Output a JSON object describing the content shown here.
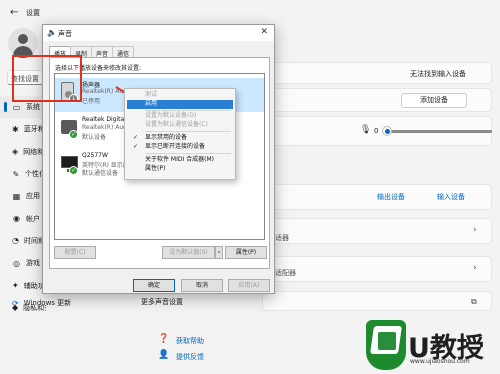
{
  "settings": {
    "back_icon": "←",
    "title": "设置",
    "search_placeholder": "查找设置",
    "nav": [
      {
        "label": "系统",
        "icon": "▭"
      },
      {
        "label": "蓝牙和其他设备",
        "icon": "✱"
      },
      {
        "label": "网络和 Internet",
        "icon": "◈"
      },
      {
        "label": "个性化",
        "icon": "✎"
      },
      {
        "label": "应用",
        "icon": "▦"
      },
      {
        "label": "帐户",
        "icon": "◉"
      },
      {
        "label": "时间和语言",
        "icon": "◔"
      },
      {
        "label": "游戏",
        "icon": "◎"
      },
      {
        "label": "辅助功能",
        "icon": "✦"
      },
      {
        "label": "隐私和安全性",
        "icon": "◆"
      }
    ],
    "windows_update": "Windows 更新",
    "no_device_found": "无法找到输入设备",
    "add_device_button": "添加设备",
    "input_volume": "0",
    "output_device_link": "输出设备",
    "input_device_link": "输入设备",
    "row1_tail": "适器",
    "row2_tail": "适配器",
    "more_sound_settings": "更多声音设置",
    "get_help": "获取帮助",
    "give_feedback": "提供反馈"
  },
  "dialog": {
    "title": "声音",
    "close_icon": "✕",
    "tabs": [
      "播放",
      "录制",
      "声音",
      "通信"
    ],
    "instruction": "选择以下播放设备来修改其设置:",
    "devices": [
      {
        "name": "扬声器",
        "sub": "Realtek(R) Audio",
        "status": "已停用",
        "icon": "speaker-icon"
      },
      {
        "name": "Realtek Digital Output",
        "sub": "Realtek(R) Audio",
        "status": "默认设备",
        "icon": "digital-output-icon"
      },
      {
        "name": "Q2577W",
        "sub": "英特尔(R) 显示器音频",
        "status": "默认通信设备",
        "icon": "monitor-icon"
      }
    ],
    "configure_button": "配置(C)",
    "set_default_button": "设为默认值(S)",
    "properties_button": "属性(P)",
    "ok_button": "确定",
    "cancel_button": "取消",
    "apply_button": "应用(A)"
  },
  "context_menu": {
    "items": [
      {
        "label": "测试",
        "state": "disabled"
      },
      {
        "label": "启用",
        "state": "highlighted"
      },
      {
        "label": "设置为默认设备(D)",
        "state": "disabled"
      },
      {
        "label": "设置为默认通信设备(C)",
        "state": "disabled"
      },
      {
        "label": "显示禁用的设备",
        "state": "checked"
      },
      {
        "label": "显示已断开连接的设备",
        "state": "checked"
      },
      {
        "label": "关于软件 MIDI 合成器(M)",
        "state": "normal"
      },
      {
        "label": "属性(P)",
        "state": "normal"
      }
    ]
  },
  "watermark": {
    "brand": "U教授",
    "url": "www.ujiaoshou.com"
  },
  "colors": {
    "accent": "#0067c0",
    "highlight": "#2a7fd4",
    "annotation_red": "#e03020",
    "selection": "#cce8ff"
  }
}
